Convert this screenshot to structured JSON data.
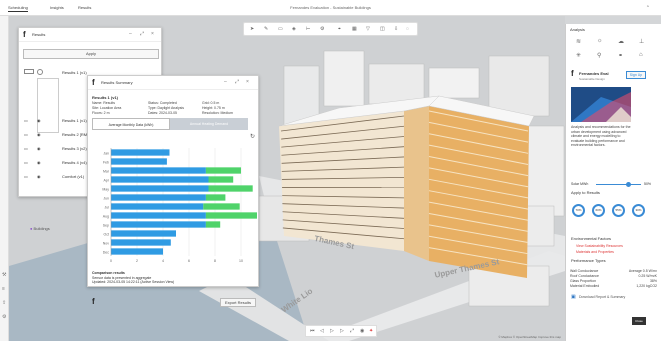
{
  "topbar": {
    "tabs": [
      "Scheduling",
      "Insights",
      "Results"
    ],
    "title": "Fernandes Evaluation - Sustainable Buildings",
    "user_icon": "user-icon"
  },
  "left_rail": {
    "icons": [
      "hammer-icon",
      "layers-icon",
      "upload-icon",
      "settings-icon"
    ]
  },
  "map": {
    "road_labels": [
      "Upper Thames St",
      "White Lio",
      "Thames St"
    ],
    "attribution": "© Mapbox © OpenStreetMap Improve this map"
  },
  "toolbar": {
    "icons": [
      "cursor-icon",
      "pen-icon",
      "box-icon",
      "cube-icon",
      "ruler-icon",
      "settings-icon",
      "measure-icon",
      "grid-icon",
      "filter-icon",
      "layers-icon",
      "download-icon",
      "hide-icon"
    ]
  },
  "bottom_bar": {
    "icons": [
      "first-icon",
      "prev-icon",
      "play-icon",
      "next-icon",
      "fullscreen-icon",
      "camera-icon",
      "pin-icon"
    ]
  },
  "results_panel": {
    "title": "Results",
    "apply_label": "Apply",
    "rows": [
      {
        "label": "Results 1 (v1)"
      },
      {
        "label": "Results 2 [RM]"
      },
      {
        "label": "Results 3 (v2)"
      },
      {
        "label": "Results 4 (v4)"
      },
      {
        "label": "Comfort (v1)"
      }
    ],
    "extra_label": "Buildings"
  },
  "chart_panel": {
    "title": "Results Summary",
    "subtitle": "Results 1 (v1)",
    "meta_col1": [
      "Name: Results",
      "Site: Location Area",
      "Floors: 2 m"
    ],
    "meta_col2": [
      "Status: Completed",
      "Type: Daylight Analysis",
      "Dates: 2024-03-05"
    ],
    "meta_col3": [
      "Grid: 0.5 m",
      "Height: 0.75 m",
      "Resolution: Medium"
    ],
    "tab1": "Average Monthly Data (kWh)",
    "tab2": "Annual Heating Demand",
    "footer_title": "Comparison results",
    "footer_line1": "Sensor data is presented in aggregate",
    "footer_line2": "Updated: 2024-03-05 14:22:11 (Active Session View)",
    "export_label": "Export Results"
  },
  "right_panel": {
    "header": "Analysis",
    "brand": "Fernandes Eval",
    "subbrand": "Sustainable Design",
    "signup_label": "Sign Up",
    "description": "Analysis and recommendations for the urban development using advanced climate and energy modelling to evaluate building performance and environmental factors.",
    "toggle_label": "Solar MWh",
    "slider_value": "50%",
    "rating_title": "Apply to Results",
    "gauges": [
      "70%",
      "60%",
      "55%",
      "30%"
    ],
    "section_title": "Environmental Factors",
    "links": [
      "View Sustainability Resources",
      "Materials and Properties"
    ],
    "table_title": "Performance Types",
    "table_rows": [
      {
        "label": "Wall Conductance",
        "value": "Average 0.5 W/m²"
      },
      {
        "label": "Roof Conductance",
        "value": "0.25 W/m²K"
      },
      {
        "label": "Glass Proportion",
        "value": "38%"
      },
      {
        "label": "Material Embodied",
        "value": "1,220 kgCO2"
      }
    ],
    "footer_link": "Download Report & Summary",
    "bottom_button": "Close"
  },
  "chart_data": {
    "type": "bar",
    "orientation": "horizontal",
    "categories": [
      "Jan",
      "Feb",
      "Mar",
      "Apr",
      "May",
      "Jun",
      "Jul",
      "Aug",
      "Sep",
      "Oct",
      "Nov",
      "Dec"
    ],
    "series": [
      {
        "name": "",
        "color": "#2f9be3",
        "values": [
          4.5,
          4.3,
          7.3,
          7.5,
          7.5,
          7.3,
          7.1,
          7.3,
          7.3,
          5.0,
          4.6,
          4.0
        ]
      },
      {
        "name": "",
        "color": "#4fd36a",
        "values": [
          0,
          0,
          2.7,
          1.9,
          3.4,
          1.5,
          2.8,
          5.5,
          1.1,
          0,
          0,
          0
        ]
      }
    ],
    "xlim": [
      0,
      10
    ],
    "xticks": [
      "0",
      "2",
      "4",
      "6",
      "8",
      "10"
    ],
    "grid": true,
    "stacked": true
  },
  "colors": {
    "accent": "#2f9be3",
    "green": "#4fd36a",
    "building_orange": "#e8b064"
  }
}
